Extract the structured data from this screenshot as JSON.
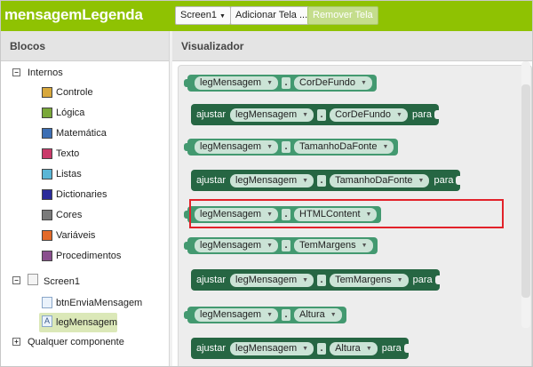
{
  "app": {
    "title": "mensagemLegenda"
  },
  "toolbar": {
    "screen_select": "Screen1",
    "add_screen": "Adicionar Tela ...",
    "remove_screen": "Remover Tela"
  },
  "blocks_panel": {
    "header": "Blocos",
    "builtin": {
      "label": "Internos",
      "items": [
        {
          "label": "Controle",
          "color": "#d8a83c"
        },
        {
          "label": "Lógica",
          "color": "#7aa83a"
        },
        {
          "label": "Matemática",
          "color": "#3d6fb4"
        },
        {
          "label": "Texto",
          "color": "#c93a6a"
        },
        {
          "label": "Listas",
          "color": "#5bb6d6"
        },
        {
          "label": "Dictionaries",
          "color": "#2a2a9a"
        },
        {
          "label": "Cores",
          "color": "#7a7a7a"
        },
        {
          "label": "Variáveis",
          "color": "#e26a2a"
        },
        {
          "label": "Procedimentos",
          "color": "#8a4f8e"
        }
      ]
    },
    "screen": {
      "label": "Screen1",
      "components": [
        {
          "label": "btnEnviaMensagem"
        },
        {
          "label": "legMensagem"
        }
      ]
    },
    "any_component": "Qualquer componente"
  },
  "viewer": {
    "header": "Visualizador",
    "blocks": [
      {
        "kind": "get",
        "component": "legMensagem",
        "property": "CorDeFundo"
      },
      {
        "kind": "set",
        "set_word": "ajustar",
        "component": "legMensagem",
        "property": "CorDeFundo",
        "to_word": "para"
      },
      {
        "kind": "get",
        "component": "legMensagem",
        "property": "TamanhoDaFonte"
      },
      {
        "kind": "set",
        "set_word": "ajustar",
        "component": "legMensagem",
        "property": "TamanhoDaFonte",
        "to_word": "para"
      },
      {
        "kind": "get",
        "component": "legMensagem",
        "property": "HTMLContent"
      },
      {
        "kind": "get",
        "component": "legMensagem",
        "property": "TemMargens"
      },
      {
        "kind": "set",
        "set_word": "ajustar",
        "component": "legMensagem",
        "property": "TemMargens",
        "to_word": "para"
      },
      {
        "kind": "get",
        "component": "legMensagem",
        "property": "Altura"
      },
      {
        "kind": "set",
        "set_word": "ajustar",
        "component": "legMensagem",
        "property": "Altura",
        "to_word": "para"
      }
    ]
  },
  "colors": {
    "topbar": "#8fc202",
    "getter_block": "#439970",
    "setter_block": "#266643",
    "highlight": "#e2222a"
  }
}
